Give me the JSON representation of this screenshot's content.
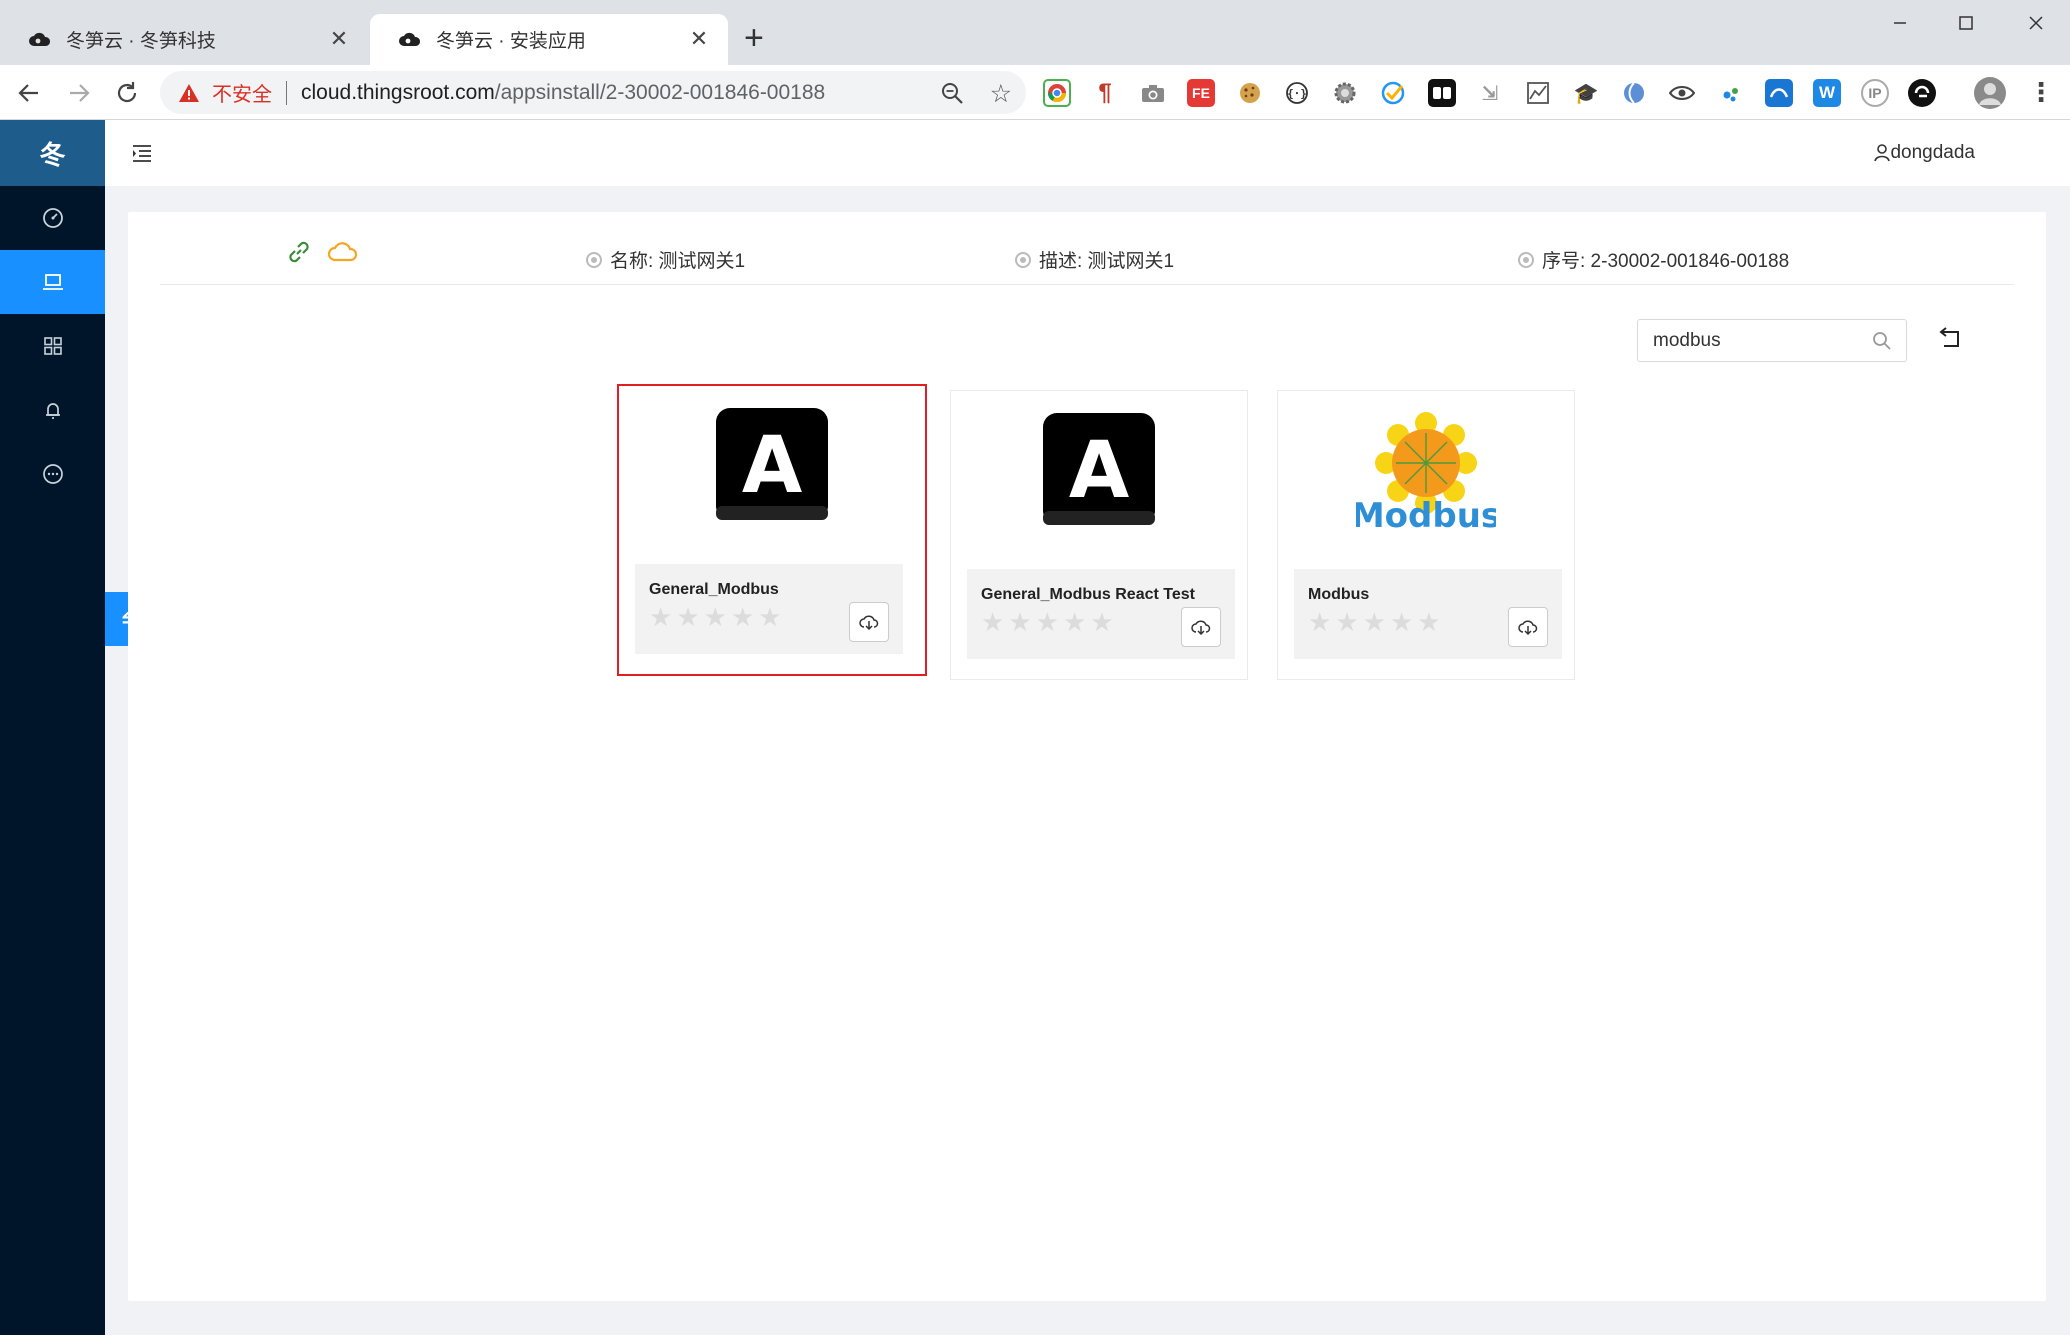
{
  "browser": {
    "tabs": [
      {
        "title": "冬笋云 · 冬笋科技",
        "active": false
      },
      {
        "title": "冬笋云 · 安装应用",
        "active": true
      }
    ],
    "new_tab_label": "+",
    "close_label": "✕",
    "security_label": "不安全",
    "url_host": "cloud.thingsroot.com",
    "url_path": "/appsinstall/2-30002-001846-00188",
    "menu_label": "⋮"
  },
  "app": {
    "logo_text": "冬",
    "sidebar": {
      "items": [
        {
          "icon": "dashboard-icon",
          "active": false
        },
        {
          "icon": "laptop-icon",
          "active": true
        },
        {
          "icon": "appstore-icon",
          "active": false
        },
        {
          "icon": "bell-icon",
          "active": false
        },
        {
          "icon": "message-icon",
          "active": false
        }
      ],
      "collapse_label": "⇋"
    },
    "header": {
      "username": "dongdada"
    },
    "gateway": {
      "name_label": "名称: 测试网关1",
      "desc_label": "描述: 测试网关1",
      "serial_label": "序号: 2-30002-001846-00188"
    },
    "search": {
      "value": "modbus"
    },
    "apps": [
      {
        "name": "General_Modbus",
        "logo": "A",
        "rating": 0,
        "selected": true
      },
      {
        "name": "General_Modbus React Test",
        "logo": "A",
        "rating": 0,
        "selected": false
      },
      {
        "name": "Modbus",
        "logo": "Modbus",
        "rating": 0,
        "selected": false
      }
    ],
    "colors": {
      "sidebar_bg": "#001529",
      "accent": "#1890ff",
      "selected_border": "#e02020",
      "link_icon": "#3a8a3a",
      "cloud_icon": "#f5a623"
    }
  }
}
